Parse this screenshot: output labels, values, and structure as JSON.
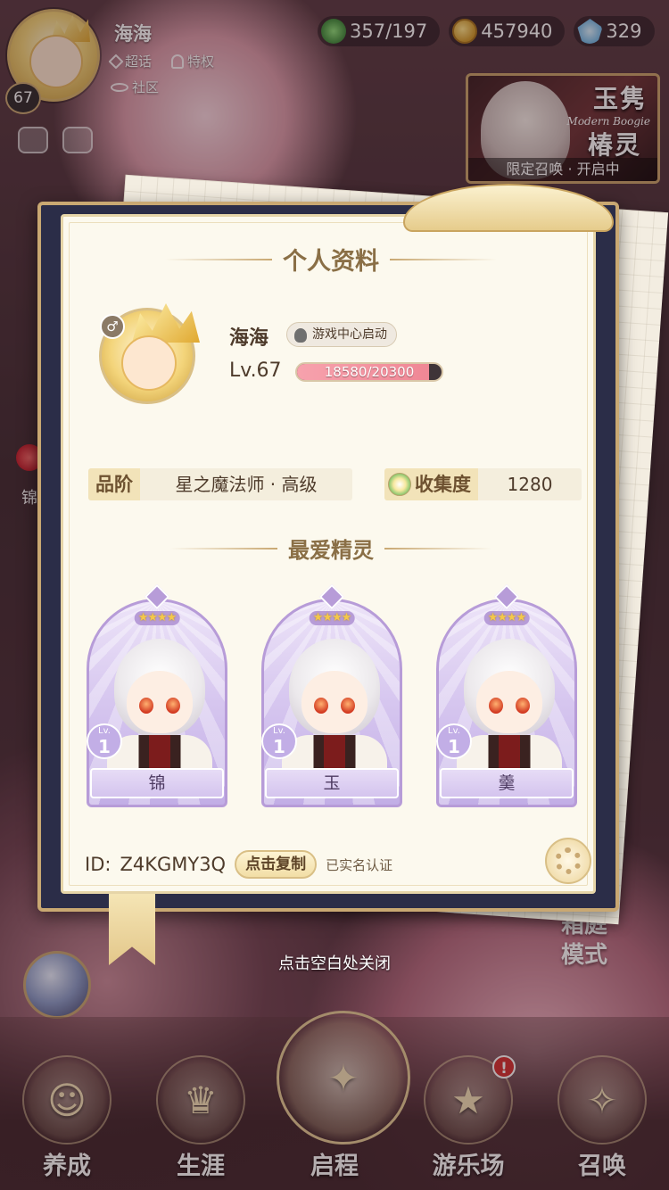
{
  "topbar": {
    "player_name": "海海",
    "level": "67",
    "links": [
      {
        "label": "超话",
        "icon": "diamond-icon"
      },
      {
        "label": "特权",
        "icon": "bell-icon"
      },
      {
        "label": "社区",
        "icon": "mask-icon"
      }
    ]
  },
  "resources": {
    "clover": "357/197",
    "coins": "457940",
    "gems": "329"
  },
  "event_banner": {
    "title_line1": "玉隽",
    "subtitle": "Modern Boogie",
    "title_line2": "椿灵",
    "status": "限定召唤 · 开启中"
  },
  "side": {
    "left_label": "锦",
    "courtyard_line1": "箱庭",
    "courtyard_line2": "模式"
  },
  "profile": {
    "title": "个人资料",
    "name": "海海",
    "qq_badge": "游戏中心启动",
    "level_label": "Lv.67",
    "exp_text": "18580/20300",
    "exp_fraction": 0.915,
    "rank_label": "品阶",
    "rank_value": "星之魔法师 · 高级",
    "collect_label": "收集度",
    "collect_value": "1280",
    "fav_title": "最爱精灵",
    "favorites": [
      {
        "name": "锦",
        "lv_label": "Lv.",
        "level": "1",
        "stars": "★★★★"
      },
      {
        "name": "玉",
        "lv_label": "Lv.",
        "level": "1",
        "stars": "★★★★"
      },
      {
        "name": "羹",
        "lv_label": "Lv.",
        "level": "1",
        "stars": "★★★★"
      }
    ],
    "id_label": "ID:",
    "id_value": "Z4KGMY3Q",
    "copy_label": "点击复制",
    "verified_label": "已实名认证"
  },
  "close_hint": "点击空白处关闭",
  "nav": [
    {
      "label": "养成",
      "icon": "girl-icon",
      "glyph": "☺"
    },
    {
      "label": "生涯",
      "icon": "crown-icon",
      "glyph": "♛"
    },
    {
      "label": "启程",
      "icon": "book-icon",
      "glyph": "✦"
    },
    {
      "label": "游乐场",
      "icon": "star-icon",
      "glyph": "★",
      "alert": "!"
    },
    {
      "label": "召唤",
      "icon": "card-icon",
      "glyph": "✧"
    }
  ]
}
